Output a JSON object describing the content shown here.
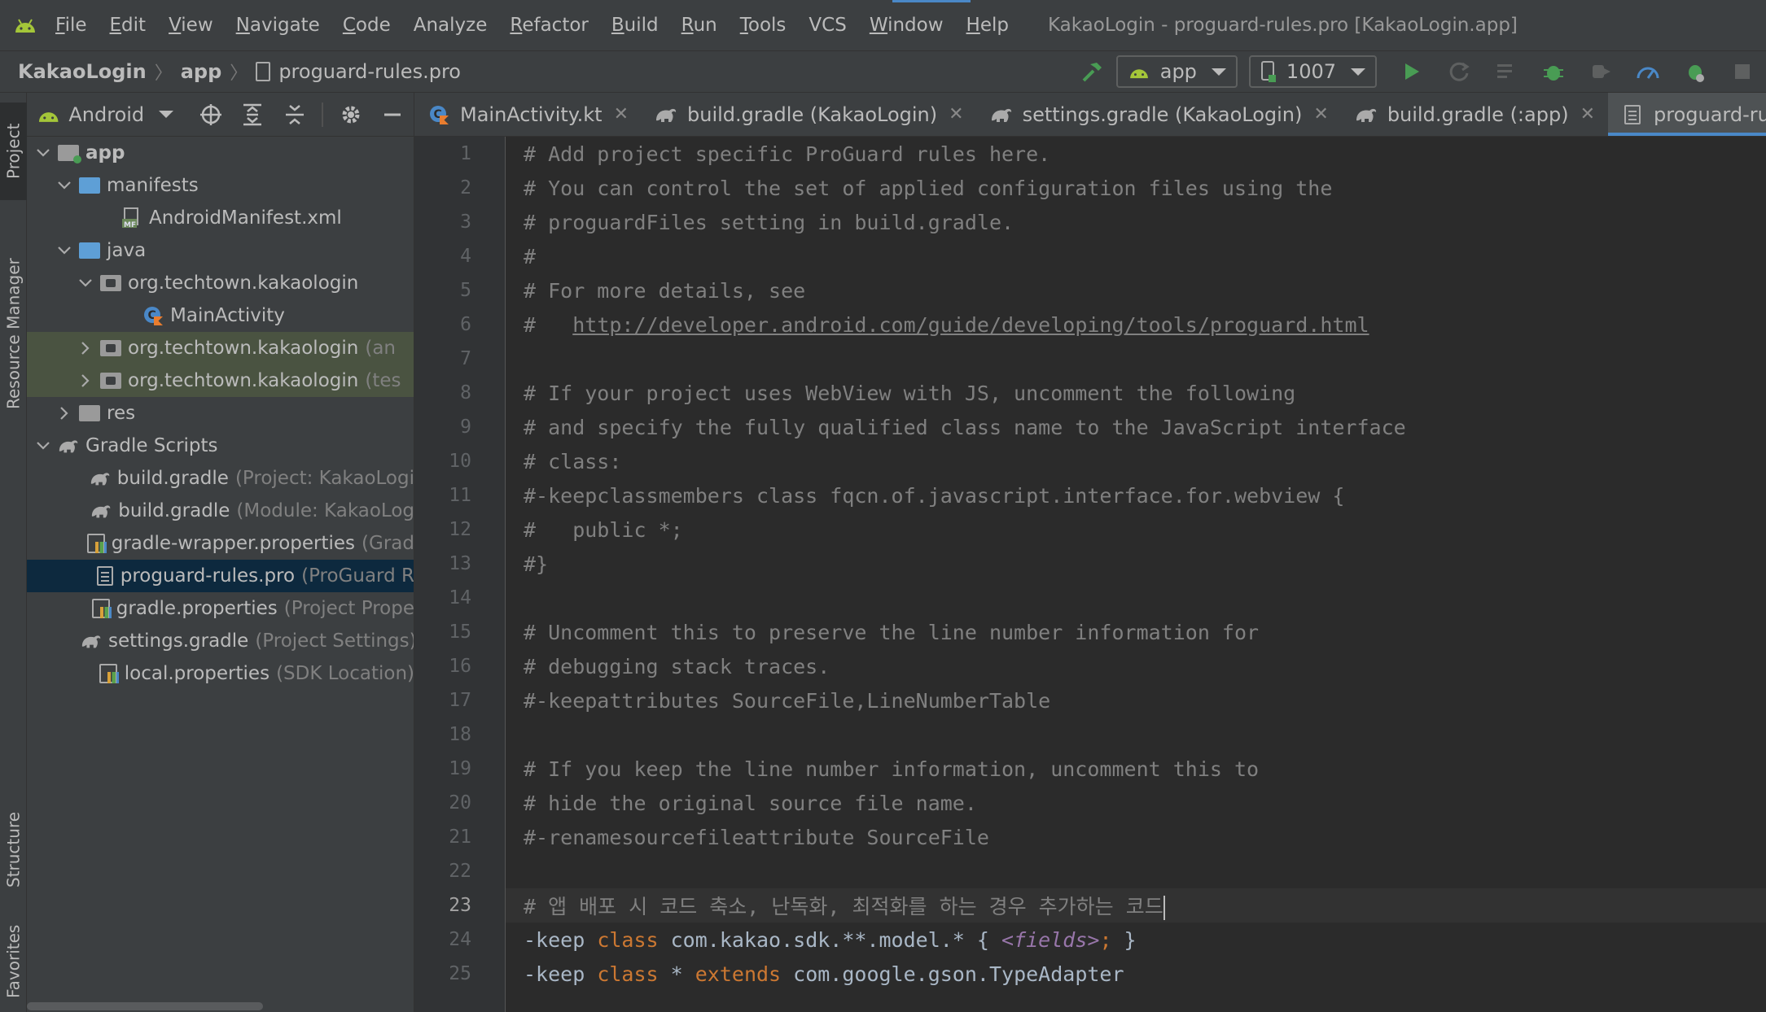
{
  "menubar": {
    "items": [
      {
        "mnemonic": "F",
        "rest": "ile"
      },
      {
        "mnemonic": "E",
        "rest": "dit"
      },
      {
        "mnemonic": "V",
        "rest": "iew"
      },
      {
        "mnemonic": "N",
        "rest": "avigate"
      },
      {
        "mnemonic": "C",
        "rest": "ode"
      },
      {
        "mnemonic": "",
        "rest": "Analyze"
      },
      {
        "mnemonic": "R",
        "rest": "efactor"
      },
      {
        "mnemonic": "B",
        "rest": "uild"
      },
      {
        "mnemonic": "R",
        "rest": "un"
      },
      {
        "mnemonic": "T",
        "rest": "ools"
      },
      {
        "mnemonic": "",
        "rest": "VCS"
      },
      {
        "mnemonic": "W",
        "rest": "indow"
      },
      {
        "mnemonic": "H",
        "rest": "elp"
      }
    ],
    "window_title": "KakaoLogin - proguard-rules.pro [KakaoLogin.app]"
  },
  "navbar": {
    "crumbs": [
      "KakaoLogin",
      "app",
      "proguard-rules.pro"
    ],
    "run_config": "app",
    "device": "1007"
  },
  "leftstrip": {
    "tabs": [
      "Project",
      "Resource Manager",
      "Structure",
      "Favorites"
    ]
  },
  "project_panel": {
    "view_mode": "Android",
    "tree": [
      {
        "label": "app",
        "hint": "",
        "icon": "folder-module",
        "arrow": "down",
        "bold": true
      },
      {
        "label": "manifests",
        "hint": "",
        "icon": "folder",
        "arrow": "down"
      },
      {
        "label": "AndroidManifest.xml",
        "hint": "",
        "icon": "manifest",
        "arrow": ""
      },
      {
        "label": "java",
        "hint": "",
        "icon": "folder",
        "arrow": "down"
      },
      {
        "label": "org.techtown.kakaologin",
        "hint": "",
        "icon": "package",
        "arrow": "down"
      },
      {
        "label": "MainActivity",
        "hint": "",
        "icon": "kotlin-class",
        "arrow": ""
      },
      {
        "label": "org.techtown.kakaologin",
        "hint": "(an",
        "icon": "package",
        "arrow": "right"
      },
      {
        "label": "org.techtown.kakaologin",
        "hint": "(tes",
        "icon": "package",
        "arrow": "right"
      },
      {
        "label": "res",
        "hint": "",
        "icon": "folder-res",
        "arrow": "right"
      },
      {
        "label": "Gradle Scripts",
        "hint": "",
        "icon": "gradle",
        "arrow": "down"
      },
      {
        "label": "build.gradle",
        "hint": "(Project: KakaoLogi",
        "icon": "gradle",
        "arrow": ""
      },
      {
        "label": "build.gradle",
        "hint": "(Module: KakaoLog",
        "icon": "gradle",
        "arrow": ""
      },
      {
        "label": "gradle-wrapper.properties",
        "hint": "(Grad",
        "icon": "properties",
        "arrow": ""
      },
      {
        "label": "proguard-rules.pro",
        "hint": "(ProGuard R",
        "icon": "file",
        "arrow": ""
      },
      {
        "label": "gradle.properties",
        "hint": "(Project Prope",
        "icon": "properties",
        "arrow": ""
      },
      {
        "label": "settings.gradle",
        "hint": "(Project Settings)",
        "icon": "gradle",
        "arrow": ""
      },
      {
        "label": "local.properties",
        "hint": "(SDK Location)",
        "icon": "properties",
        "arrow": ""
      }
    ]
  },
  "editor_tabs": [
    {
      "label": "MainActivity.kt",
      "icon": "kotlin-class",
      "active": false
    },
    {
      "label": "build.gradle (KakaoLogin)",
      "icon": "gradle",
      "active": false
    },
    {
      "label": "settings.gradle (KakaoLogin)",
      "icon": "gradle",
      "active": false
    },
    {
      "label": "build.gradle (:app)",
      "icon": "gradle",
      "active": false
    },
    {
      "label": "proguard-rules.pro",
      "icon": "file",
      "active": true
    }
  ],
  "editor": {
    "current_line": 23,
    "lines": [
      {
        "n": "1",
        "segs": [
          {
            "t": "# Add project specific ProGuard rules here.",
            "c": "comment"
          }
        ]
      },
      {
        "n": "2",
        "segs": [
          {
            "t": "# You can control the set of applied configuration files using the",
            "c": "comment"
          }
        ]
      },
      {
        "n": "3",
        "segs": [
          {
            "t": "# proguardFiles setting in build.gradle.",
            "c": "comment"
          }
        ]
      },
      {
        "n": "4",
        "segs": [
          {
            "t": "#",
            "c": "comment"
          }
        ]
      },
      {
        "n": "5",
        "segs": [
          {
            "t": "# For more details, see",
            "c": "comment"
          }
        ]
      },
      {
        "n": "6",
        "segs": [
          {
            "t": "#   ",
            "c": "comment"
          },
          {
            "t": "http://developer.android.com/guide/developing/tools/proguard.html",
            "c": "link"
          }
        ]
      },
      {
        "n": "7",
        "segs": []
      },
      {
        "n": "8",
        "segs": [
          {
            "t": "# If your project uses WebView with JS, uncomment the following",
            "c": "comment"
          }
        ]
      },
      {
        "n": "9",
        "segs": [
          {
            "t": "# and specify the fully qualified class name to the JavaScript interface",
            "c": "comment"
          }
        ]
      },
      {
        "n": "10",
        "segs": [
          {
            "t": "# class:",
            "c": "comment"
          }
        ]
      },
      {
        "n": "11",
        "segs": [
          {
            "t": "#-keepclassmembers class fqcn.of.javascript.interface.for.webview {",
            "c": "comment"
          }
        ]
      },
      {
        "n": "12",
        "segs": [
          {
            "t": "#   public *;",
            "c": "comment"
          }
        ]
      },
      {
        "n": "13",
        "segs": [
          {
            "t": "#}",
            "c": "comment"
          }
        ]
      },
      {
        "n": "14",
        "segs": []
      },
      {
        "n": "15",
        "segs": [
          {
            "t": "# Uncomment this to preserve the line number information for",
            "c": "comment"
          }
        ]
      },
      {
        "n": "16",
        "segs": [
          {
            "t": "# debugging stack traces.",
            "c": "comment"
          }
        ]
      },
      {
        "n": "17",
        "segs": [
          {
            "t": "#-keepattributes SourceFile,LineNumberTable",
            "c": "comment"
          }
        ]
      },
      {
        "n": "18",
        "segs": []
      },
      {
        "n": "19",
        "segs": [
          {
            "t": "# If you keep the line number information, uncomment this to",
            "c": "comment"
          }
        ]
      },
      {
        "n": "20",
        "segs": [
          {
            "t": "# hide the original source file name.",
            "c": "comment"
          }
        ]
      },
      {
        "n": "21",
        "segs": [
          {
            "t": "#-renamesourcefileattribute SourceFile",
            "c": "comment"
          }
        ]
      },
      {
        "n": "22",
        "segs": []
      },
      {
        "n": "23",
        "segs": [
          {
            "t": "# 앱 배포 시 코드 축소, 난독화, 최적화를 하는 경우 추가하는 코드",
            "c": "comment"
          }
        ]
      },
      {
        "n": "24",
        "segs": [
          {
            "t": "-keep ",
            "c": "default"
          },
          {
            "t": "class",
            "c": "kw"
          },
          {
            "t": " com.kakao.sdk.**.model.* { ",
            "c": "default"
          },
          {
            "t": "<fields>",
            "c": "tag"
          },
          {
            "t": ";",
            "c": "kw"
          },
          {
            "t": " }",
            "c": "default"
          }
        ]
      },
      {
        "n": "25",
        "segs": [
          {
            "t": "-keep ",
            "c": "default"
          },
          {
            "t": "class",
            "c": "kw"
          },
          {
            "t": " * ",
            "c": "default"
          },
          {
            "t": "extends",
            "c": "kw"
          },
          {
            "t": " com.google.gson.TypeAdapter",
            "c": "default"
          }
        ]
      }
    ]
  },
  "colors": {
    "accent": "#4a88c7",
    "android_green": "#a4c639",
    "run_green": "#499c54",
    "keyword": "#cc7832",
    "comment": "#808080",
    "text": "#a9b7c6",
    "tag": "#9876aa"
  }
}
